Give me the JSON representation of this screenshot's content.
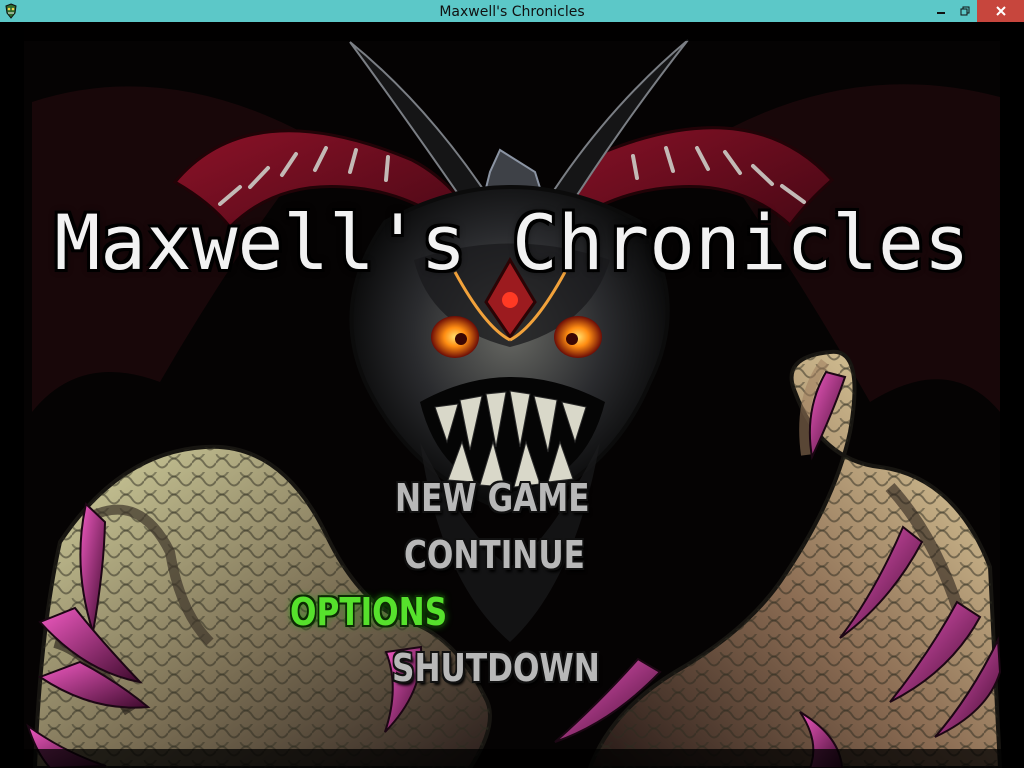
{
  "window": {
    "title": "Maxwell's Chronicles",
    "icon": "game-app-icon",
    "titlebar_color": "#5cc8c8",
    "close_color": "#c7463d"
  },
  "game": {
    "title": "Maxwell's Chronicles",
    "background_art": "demon-with-horns-and-claws",
    "menu": {
      "items": [
        {
          "label": "NEW GAME",
          "selected": false
        },
        {
          "label": "CONTINUE",
          "selected": false
        },
        {
          "label": "OPTIONS",
          "selected": true
        },
        {
          "label": "SHUTDOWN",
          "selected": false
        }
      ],
      "normal_color": "#b8b8b8",
      "selected_color": "#56e12c"
    }
  }
}
